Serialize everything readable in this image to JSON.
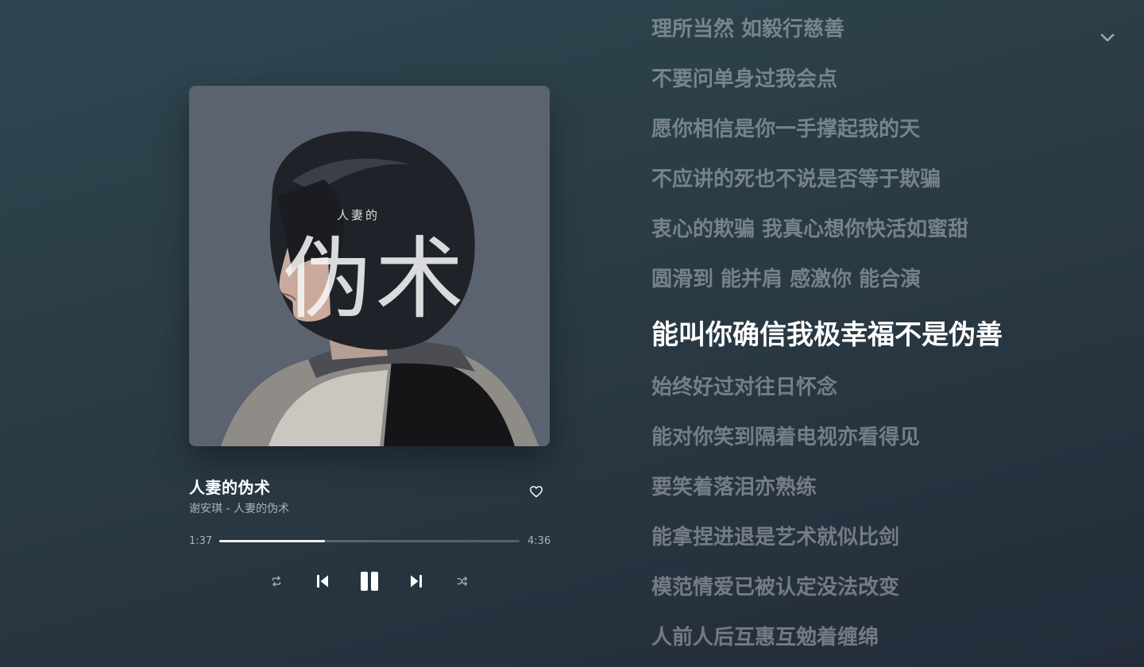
{
  "player": {
    "cover": {
      "small_text": "人妻的",
      "title_text": "伪术"
    },
    "song_title": "人妻的伪术",
    "artist_album": "谢安琪 - 人妻的伪术",
    "time_current": "1:37",
    "time_total": "4:36",
    "progress_fraction": 0.351
  },
  "lyrics": {
    "active_index": 6,
    "lines": [
      "理所当然 如毅行慈善",
      "不要问单身过我会点",
      "愿你相信是你一手撑起我的天",
      "不应讲的死也不说是否等于欺骗",
      "衷心的欺骗 我真心想你快活如蜜甜",
      "圆滑到 能并肩 感激你 能合演",
      "能叫你确信我极幸福不是伪善",
      "始终好过对往日怀念",
      "能对你笑到隔着电视亦看得见",
      "要笑着落泪亦熟练",
      "能拿捏进退是艺术就似比剑",
      "模范情爱已被认定没法改变",
      "人前人后互惠互勉着缠绵"
    ]
  },
  "icons": {
    "collapse": "chevron-down-icon",
    "like": "heart-outline-icon",
    "repeat": "repeat-icon",
    "previous": "skip-previous-icon",
    "pause": "pause-icon",
    "next": "skip-next-icon",
    "shuffle": "shuffle-icon"
  }
}
